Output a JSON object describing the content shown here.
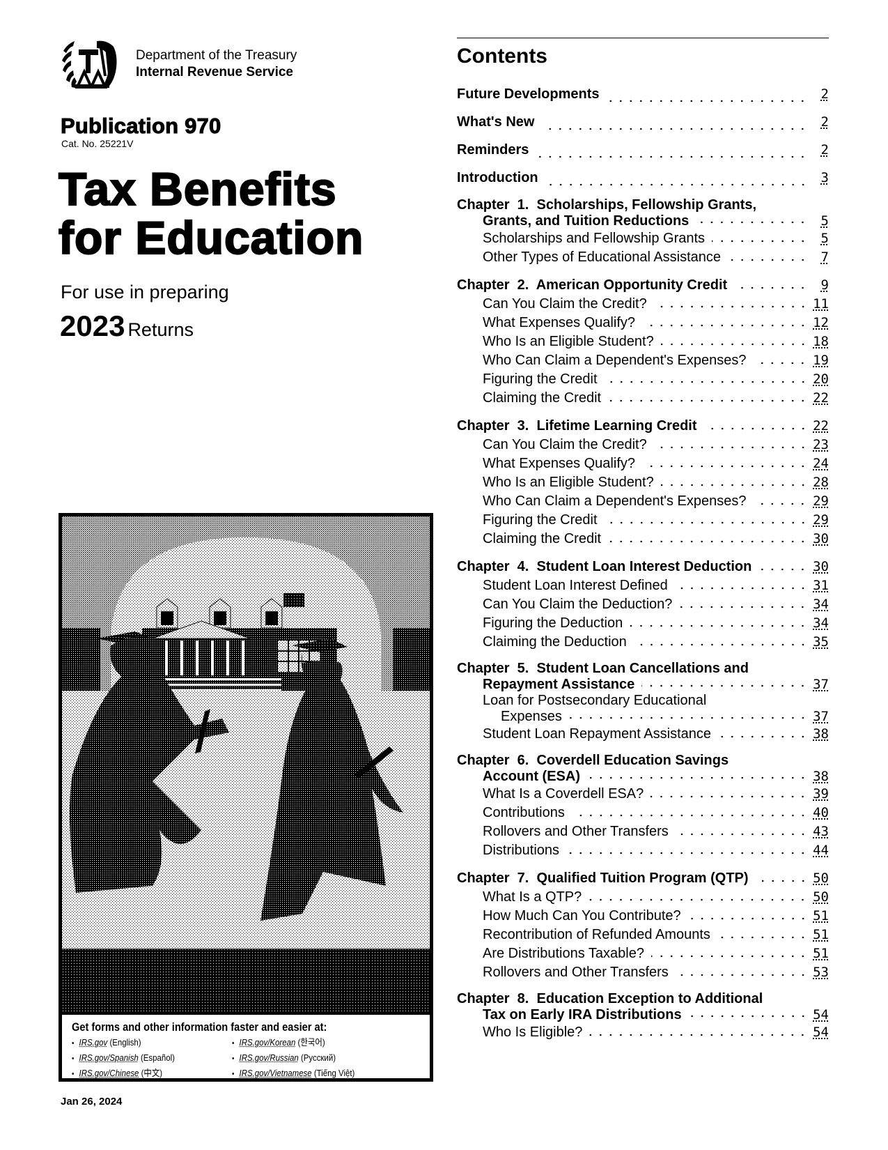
{
  "header": {
    "logo_icon": "irs-eagle-logo",
    "department": "Department of the Treasury",
    "agency": "Internal Revenue Service"
  },
  "publication": {
    "number": "Publication 970",
    "catalog": "Cat. No. 25221V",
    "title_line1": "Tax Benefits",
    "title_line2": "for Education",
    "use_text": "For use in preparing",
    "year": "2023",
    "returns": "Returns"
  },
  "cover": {
    "illustration": "graduates-walking-campus-illustration",
    "info_heading": "Get forms and other information faster and easier at:",
    "links": [
      {
        "url": "IRS.gov",
        "lang": "(English)"
      },
      {
        "url": "IRS.gov/Korean",
        "lang": "(한국어)"
      },
      {
        "url": "IRS.gov/Spanish",
        "lang": "(Español)"
      },
      {
        "url": "IRS.gov/Russian",
        "lang": "(Pусский)"
      },
      {
        "url": "IRS.gov/Chinese",
        "lang": "(中文)"
      },
      {
        "url": "IRS.gov/Vietnamese",
        "lang": "(Tiếng Việt)"
      }
    ]
  },
  "date": "Jan 26, 2024",
  "contents": {
    "title": "Contents",
    "top_items": [
      {
        "label": "Future Developments",
        "page": "2"
      },
      {
        "label": "What's New",
        "page": "2"
      },
      {
        "label": "Reminders",
        "page": "2"
      },
      {
        "label": "Introduction",
        "page": "3"
      }
    ],
    "chapters": [
      {
        "line1": "Chapter  1.  Scholarships, Fellowship Grants,",
        "line2": "Grants, and Tuition Reductions",
        "page": "5",
        "sections": [
          {
            "label": "Scholarships and Fellowship Grants",
            "page": "5"
          },
          {
            "label": "Other Types of Educational Assistance",
            "page": "7"
          }
        ]
      },
      {
        "line1": "Chapter  2.  American Opportunity Credit",
        "page": "9",
        "sections": [
          {
            "label": "Can You Claim the Credit?",
            "page": "11"
          },
          {
            "label": "What Expenses Qualify?",
            "page": "12"
          },
          {
            "label": "Who Is an Eligible Student?",
            "page": "18"
          },
          {
            "label": "Who Can Claim a Dependent's Expenses?",
            "page": "19"
          },
          {
            "label": "Figuring the Credit",
            "page": "20"
          },
          {
            "label": "Claiming the Credit",
            "page": "22"
          }
        ]
      },
      {
        "line1": "Chapter  3.  Lifetime Learning Credit",
        "page": "22",
        "sections": [
          {
            "label": "Can You Claim the Credit?",
            "page": "23"
          },
          {
            "label": "What Expenses Qualify?",
            "page": "24"
          },
          {
            "label": "Who Is an Eligible Student?",
            "page": "28"
          },
          {
            "label": "Who Can Claim a Dependent's Expenses?",
            "page": "29"
          },
          {
            "label": "Figuring the Credit",
            "page": "29"
          },
          {
            "label": "Claiming the Credit",
            "page": "30"
          }
        ]
      },
      {
        "line1": "Chapter  4.  Student Loan Interest Deduction",
        "page": "30",
        "sections": [
          {
            "label": "Student Loan Interest Defined",
            "page": "31"
          },
          {
            "label": "Can You Claim the Deduction?",
            "page": "34"
          },
          {
            "label": "Figuring the Deduction",
            "page": "34"
          },
          {
            "label": "Claiming the Deduction",
            "page": "35"
          }
        ]
      },
      {
        "line1": "Chapter  5.  Student Loan Cancellations and",
        "line2": "Repayment Assistance",
        "page": "37",
        "sections": [
          {
            "label": "Loan for Postsecondary Educational",
            "label2": "Expenses",
            "page": "37"
          },
          {
            "label": "Student Loan Repayment Assistance",
            "page": "38"
          }
        ]
      },
      {
        "line1": "Chapter  6.  Coverdell Education Savings",
        "line2": "Account (ESA)",
        "page": "38",
        "sections": [
          {
            "label": "What Is a Coverdell ESA?",
            "page": "39"
          },
          {
            "label": "Contributions",
            "page": "40"
          },
          {
            "label": "Rollovers and Other Transfers",
            "page": "43"
          },
          {
            "label": "Distributions",
            "page": "44"
          }
        ]
      },
      {
        "line1": "Chapter  7.  Qualified Tuition Program (QTP)",
        "page": "50",
        "sections": [
          {
            "label": "What Is a QTP?",
            "page": "50"
          },
          {
            "label": "How Much Can You Contribute?",
            "page": "51"
          },
          {
            "label": "Recontribution of Refunded Amounts",
            "page": "51"
          },
          {
            "label": "Are Distributions Taxable?",
            "page": "51"
          },
          {
            "label": "Rollovers and Other Transfers",
            "page": "53"
          }
        ]
      },
      {
        "line1": "Chapter  8.  Education Exception to Additional",
        "line2": "Tax on Early IRA Distributions",
        "page": "54",
        "sections": [
          {
            "label": "Who Is Eligible?",
            "page": "54"
          }
        ]
      }
    ]
  }
}
